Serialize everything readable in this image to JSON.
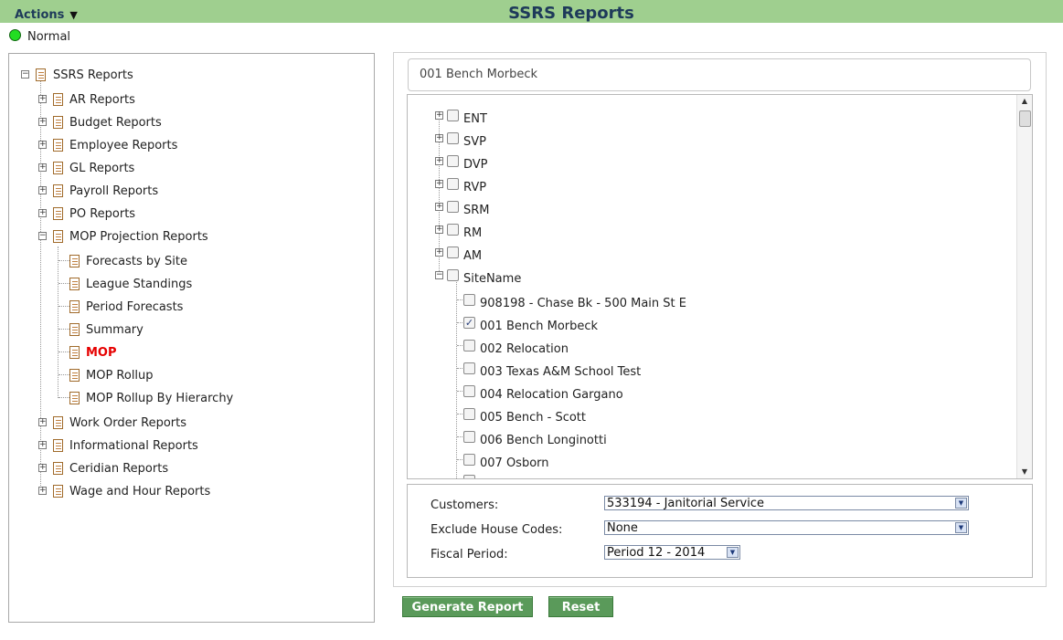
{
  "header": {
    "actions_label": "Actions",
    "title": "SSRS Reports"
  },
  "status": {
    "label": "Normal",
    "color": "#22dd22"
  },
  "tree": {
    "root": "SSRS Reports",
    "items": [
      {
        "label": "AR Reports"
      },
      {
        "label": "Budget Reports"
      },
      {
        "label": "Employee Reports"
      },
      {
        "label": "GL Reports"
      },
      {
        "label": "Payroll Reports"
      },
      {
        "label": "PO Reports"
      },
      {
        "label": "MOP Projection Reports"
      },
      {
        "label": "Forecasts by Site"
      },
      {
        "label": "League Standings"
      },
      {
        "label": "Period Forecasts"
      },
      {
        "label": "Summary"
      },
      {
        "label": "MOP"
      },
      {
        "label": "MOP Rollup"
      },
      {
        "label": "MOP Rollup By Hierarchy"
      },
      {
        "label": "Work Order Reports"
      },
      {
        "label": "Informational Reports"
      },
      {
        "label": "Ceridian Reports"
      },
      {
        "label": "Wage and Hour Reports"
      }
    ]
  },
  "selected_site": "001 Bench Morbeck",
  "hierarchy": {
    "nodes": [
      {
        "label": "ENT",
        "checked": false
      },
      {
        "label": "SVP",
        "checked": false
      },
      {
        "label": "DVP",
        "checked": false
      },
      {
        "label": "RVP",
        "checked": false
      },
      {
        "label": "SRM",
        "checked": false
      },
      {
        "label": "RM",
        "checked": false
      },
      {
        "label": "AM",
        "checked": false
      },
      {
        "label": "SiteName",
        "checked": false
      }
    ],
    "sites": [
      {
        "label": "908198 - Chase Bk - 500 Main St E",
        "checked": false
      },
      {
        "label": "001 Bench Morbeck",
        "checked": true
      },
      {
        "label": "002 Relocation",
        "checked": false
      },
      {
        "label": "003 Texas A&M School Test",
        "checked": false
      },
      {
        "label": "004 Relocation Gargano",
        "checked": false
      },
      {
        "label": "005 Bench - Scott",
        "checked": false
      },
      {
        "label": "006 Bench Longinotti",
        "checked": false
      },
      {
        "label": "007 Osborn",
        "checked": false
      }
    ]
  },
  "params": {
    "customers_label": "Customers:",
    "customers_value": "533194 - Janitorial Service",
    "exclude_label": "Exclude House Codes:",
    "exclude_value": "None",
    "period_label": "Fiscal Period:",
    "period_value": "Period 12 - 2014"
  },
  "buttons": {
    "generate": "Generate Report",
    "reset": "Reset"
  }
}
